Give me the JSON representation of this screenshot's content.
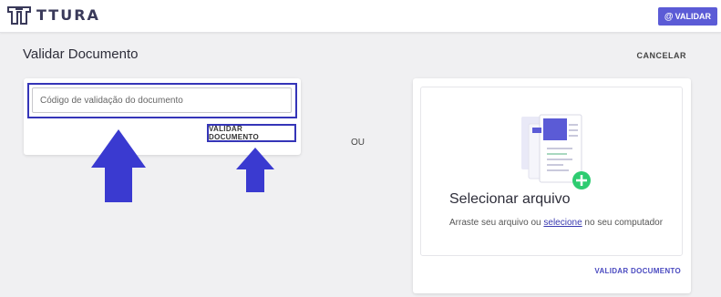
{
  "header": {
    "logo_text": "TTURA",
    "validar_label": "VALIDAR",
    "validar_icon": "at-icon"
  },
  "page": {
    "title": "Validar Documento",
    "cancel_label": "CANCELAR"
  },
  "code_form": {
    "placeholder": "Código de validação do documento",
    "value": "",
    "submit_label": "VALIDAR DOCUMENTO"
  },
  "separator": "OU",
  "upload": {
    "title": "Selecionar arquivo",
    "sub_prefix": "Arraste seu arquivo ou ",
    "sub_link": "selecione",
    "sub_suffix": " no seu computador",
    "submit_label": "VALIDAR DOCUMENTO"
  },
  "colors": {
    "accent": "#5b5bd6",
    "highlight_border": "#3535b8",
    "arrow": "#3a3ad0",
    "add_badge": "#2ecc71"
  }
}
